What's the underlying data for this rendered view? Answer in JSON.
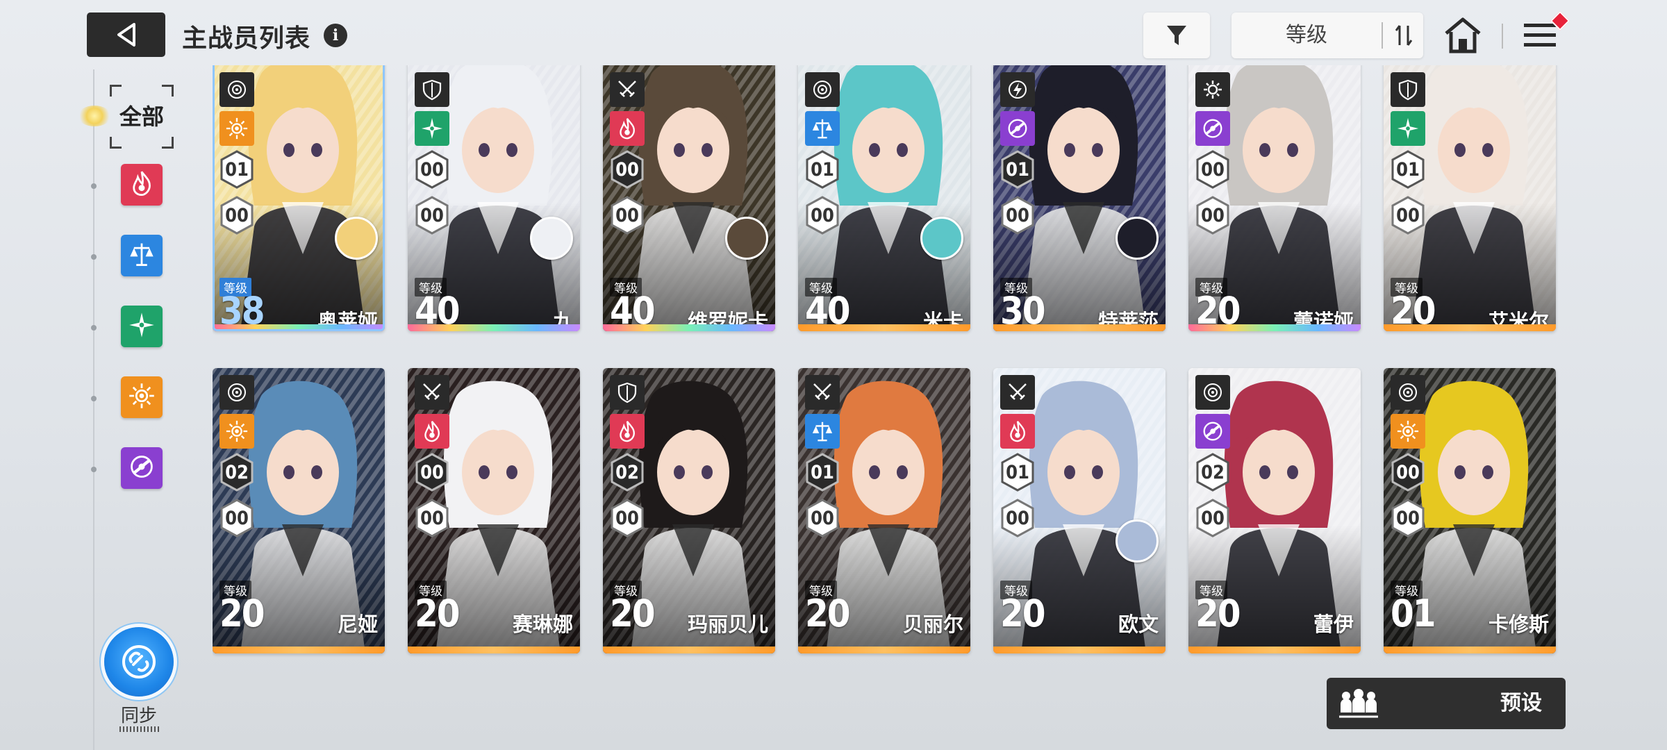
{
  "header": {
    "title": "主战员列表",
    "info_icon": "i",
    "sort_label": "等级",
    "icons": [
      "back-arrow-icon",
      "info-icon",
      "filter-funnel-icon",
      "sort-toggle-icon",
      "home-icon",
      "menu-icon"
    ]
  },
  "filters": {
    "all_label": "全部",
    "elements": [
      {
        "name": "fire",
        "color": "#e03a55"
      },
      {
        "name": "balance",
        "color": "#2c86e0"
      },
      {
        "name": "wind",
        "color": "#1fa36a"
      },
      {
        "name": "light",
        "color": "#f0901e"
      },
      {
        "name": "void",
        "color": "#8a3fd0"
      }
    ]
  },
  "sync": {
    "label": "同步"
  },
  "preset": {
    "label": "预设"
  },
  "roster": {
    "level_tag": "等级",
    "cards": [
      {
        "name": "奥莱娅",
        "level": "38",
        "rank_a": "01",
        "rank_b": "00",
        "element": "light",
        "weapon": "target",
        "rarity": "rainbow",
        "bg": "#f3e1a0",
        "hair": "#f2d07a",
        "selected": true,
        "portrait": true
      },
      {
        "name": "九",
        "level": "40",
        "rank_a": "00",
        "rank_b": "00",
        "element": "wind",
        "weapon": "shield",
        "rarity": "rainbow",
        "bg": "#e6e8ee",
        "hair": "#eef0f4",
        "selected": false,
        "portrait": true
      },
      {
        "name": "维罗妮卡",
        "level": "40",
        "rank_a": "00",
        "rank_b": "00",
        "element": "fire",
        "weapon": "blades",
        "rarity": "rainbow",
        "bg": "#3d3628",
        "hair": "#5a4a3a",
        "selected": false,
        "portrait": true
      },
      {
        "name": "米卡",
        "level": "40",
        "rank_a": "01",
        "rank_b": "00",
        "element": "balance",
        "weapon": "target",
        "rarity": "orange",
        "bg": "#dfe6ea",
        "hair": "#5cc6c8",
        "selected": false,
        "portrait": true
      },
      {
        "name": "特莱莎",
        "level": "30",
        "rank_a": "01",
        "rank_b": "00",
        "element": "void",
        "weapon": "bolt",
        "rarity": "orange",
        "bg": "#3a3d6a",
        "hair": "#1e1e2a",
        "selected": false,
        "portrait": true
      },
      {
        "name": "蕾诺娅",
        "level": "20",
        "rank_a": "00",
        "rank_b": "00",
        "element": "void",
        "weapon": "gear",
        "rarity": "rainbow",
        "bg": "#ececf0",
        "hair": "#c9c6c3",
        "selected": false,
        "portrait": false
      },
      {
        "name": "艾米尔",
        "level": "20",
        "rank_a": "01",
        "rank_b": "00",
        "element": "wind",
        "weapon": "shield",
        "rarity": "orange",
        "bg": "#eae6e2",
        "hair": "#efe9e4",
        "selected": false,
        "portrait": false
      },
      {
        "name": "尼娅",
        "level": "20",
        "rank_a": "02",
        "rank_b": "00",
        "element": "light",
        "weapon": "target",
        "rarity": "orange",
        "bg": "#2d3b55",
        "hair": "#5a8cb8",
        "selected": false,
        "portrait": false
      },
      {
        "name": "赛琳娜",
        "level": "20",
        "rank_a": "00",
        "rank_b": "00",
        "element": "fire",
        "weapon": "blades",
        "rarity": "orange",
        "bg": "#2a2020",
        "hair": "#f2f2f4",
        "selected": false,
        "portrait": false
      },
      {
        "name": "玛丽贝儿",
        "level": "20",
        "rank_a": "02",
        "rank_b": "00",
        "element": "fire",
        "weapon": "shield",
        "rarity": "orange",
        "bg": "#2b2624",
        "hair": "#1e1a1a",
        "selected": false,
        "portrait": false
      },
      {
        "name": "贝丽尔",
        "level": "20",
        "rank_a": "01",
        "rank_b": "00",
        "element": "balance",
        "weapon": "blades",
        "rarity": "orange",
        "bg": "#3a3230",
        "hair": "#e07a40",
        "selected": false,
        "portrait": false
      },
      {
        "name": "欧文",
        "level": "20",
        "rank_a": "01",
        "rank_b": "00",
        "element": "fire",
        "weapon": "blades",
        "rarity": "orange",
        "bg": "#e8eef5",
        "hair": "#aabbd8",
        "selected": false,
        "portrait": true
      },
      {
        "name": "蕾伊",
        "level": "20",
        "rank_a": "02",
        "rank_b": "00",
        "element": "void",
        "weapon": "target",
        "rarity": "orange",
        "bg": "#efeff2",
        "hair": "#b0344e",
        "selected": false,
        "portrait": false
      },
      {
        "name": "卡修斯",
        "level": "01",
        "rank_a": "00",
        "rank_b": "00",
        "element": "light",
        "weapon": "target",
        "rarity": "orange",
        "bg": "#2a2a26",
        "hair": "#e6c820",
        "selected": false,
        "portrait": false
      }
    ]
  }
}
